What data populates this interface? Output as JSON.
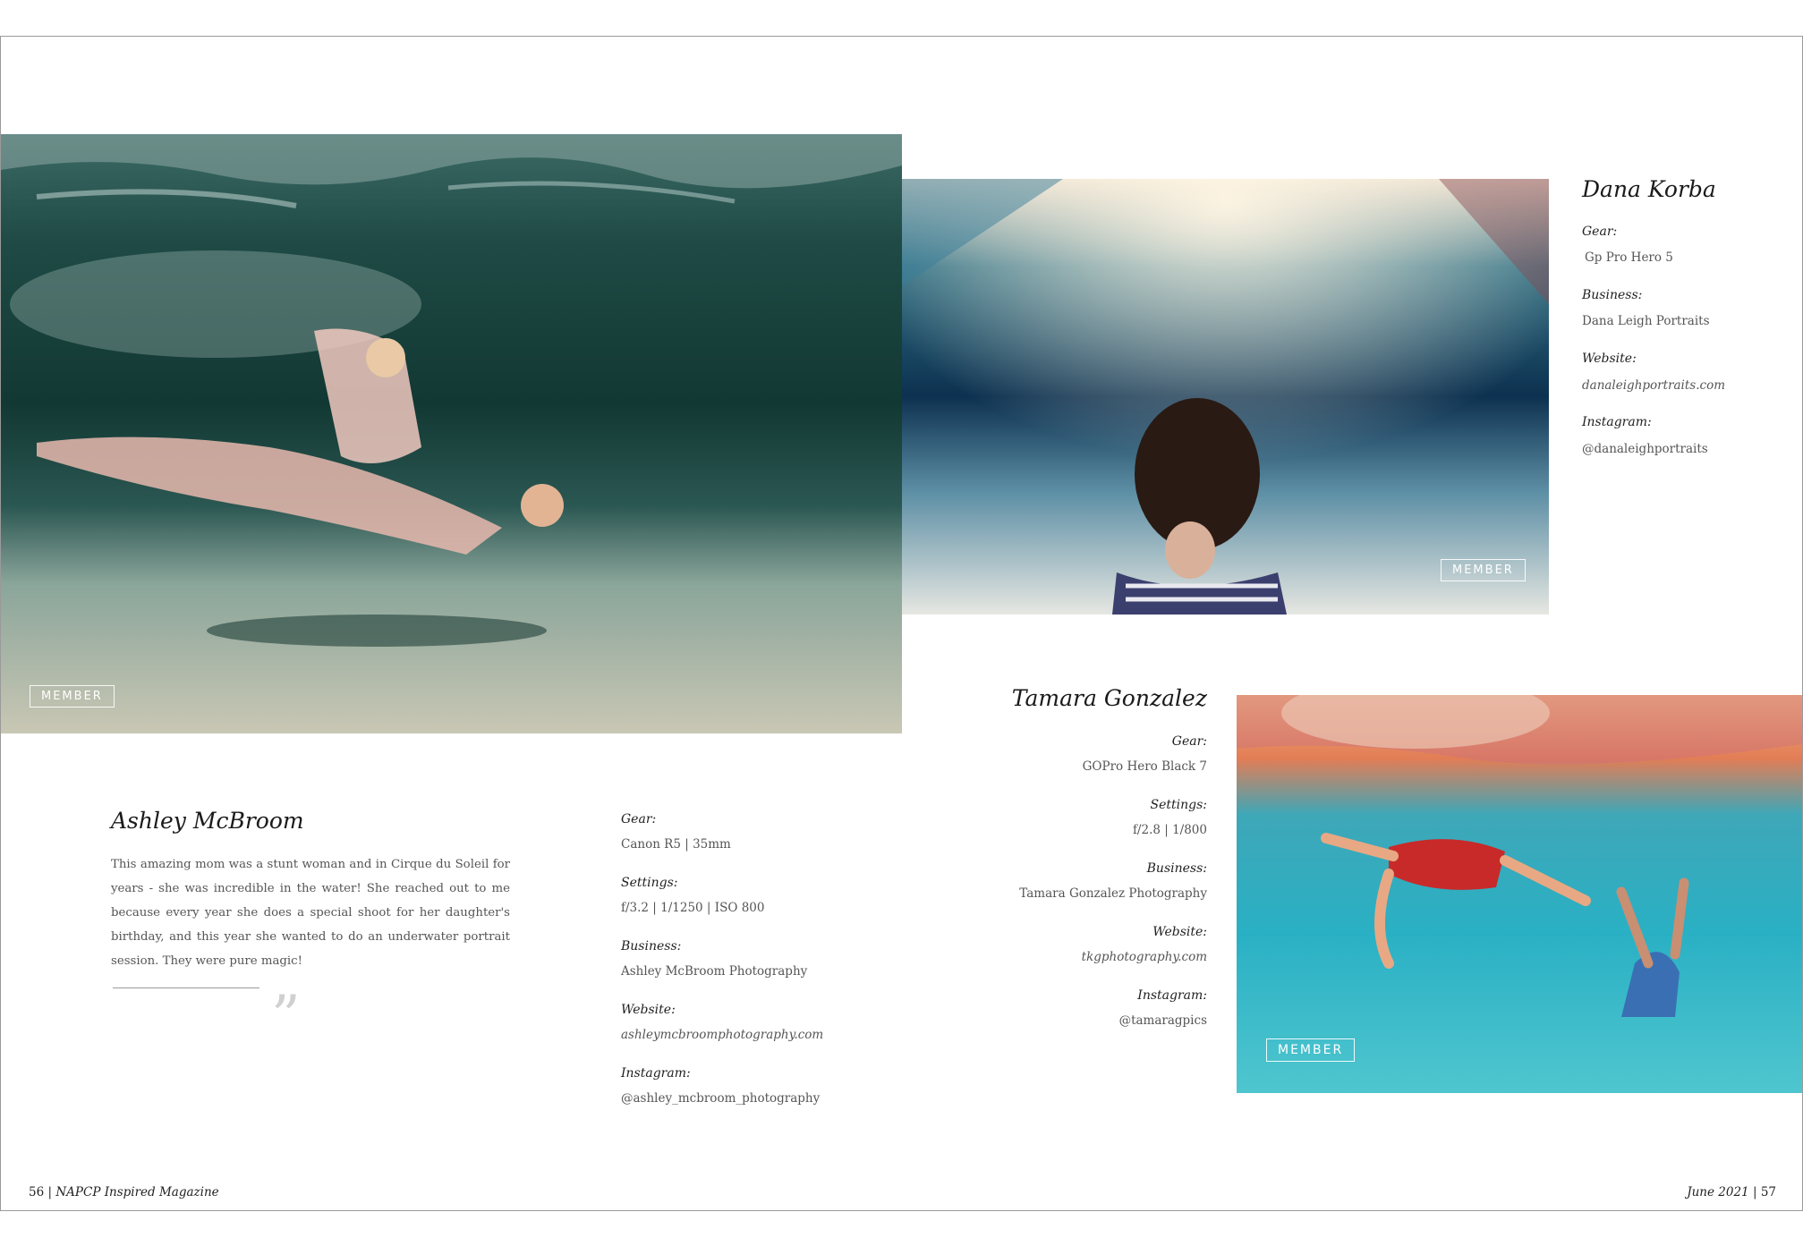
{
  "left_feature": {
    "badge": "MEMBER",
    "name": "Ashley McBroom",
    "bio": "This amazing mom was a stunt woman and in Cirque du Soleil for years - she was incredible in the water! She reached out to me because every year she does a special shoot for her daughter's birthday, and this year she wanted to do an underwater portrait session. They were pure magic!",
    "quote_mark": "”",
    "gear_label": "Gear:",
    "gear": "Canon R5  |  35mm",
    "settings_label": "Settings:",
    "settings": "f/3.2  |  1/1250  |  ISO 800",
    "business_label": "Business:",
    "business": "Ashley McBroom Photography",
    "website_label": "Website:",
    "website": "ashleymcbroomphotography.com",
    "instagram_label": "Instagram:",
    "instagram": "@ashley_mcbroom_photography"
  },
  "top_right_feature": {
    "badge": "MEMBER",
    "name": "Dana Korba",
    "gear_label": "Gear:",
    "gear": "Gp Pro Hero 5",
    "business_label": "Business:",
    "business": "Dana Leigh Portraits",
    "website_label": "Website:",
    "website": "danaleighportraits.com",
    "instagram_label": "Instagram:",
    "instagram": "@danaleighportraits"
  },
  "bottom_right_feature": {
    "badge": "MEMBER",
    "name": "Tamara Gonzalez",
    "gear_label": "Gear:",
    "gear": "GOPro Hero Black 7",
    "settings_label": "Settings:",
    "settings": "f/2.8  |  1/800",
    "business_label": "Business:",
    "business": "Tamara Gonzalez Photography",
    "website_label": "Website:",
    "website": "tkgphotography.com",
    "instagram_label": "Instagram:",
    "instagram": "@tamaragpics"
  },
  "footer": {
    "left_page": "56",
    "left_title": "NAPCP Inspired Magazine",
    "right_issue": "June 2021",
    "right_page": "57",
    "separator": "|"
  }
}
